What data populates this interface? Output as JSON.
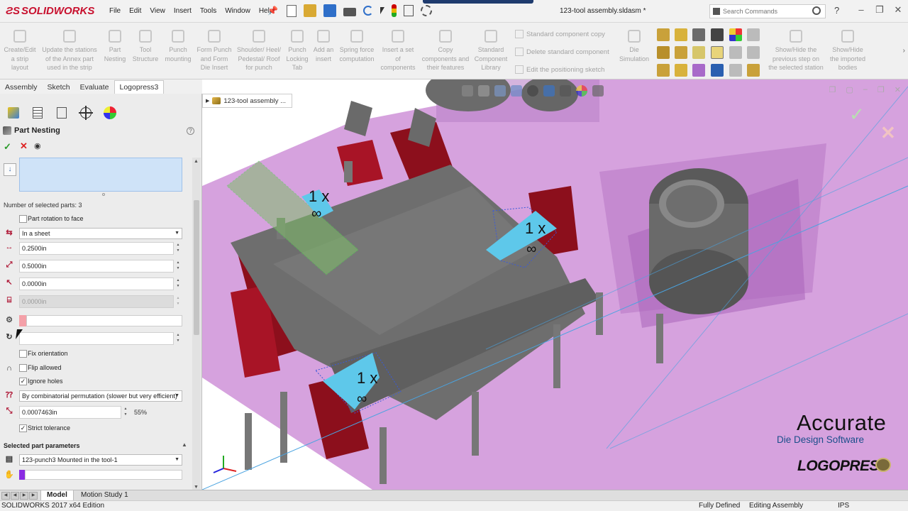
{
  "app": {
    "brand": "SOLIDWORKS",
    "menus": [
      "File",
      "Edit",
      "View",
      "Insert",
      "Tools",
      "Window",
      "Help"
    ],
    "document_title": "123-tool assembly.sldasm *",
    "search_placeholder": "Search Commands"
  },
  "commands": [
    {
      "label": "Create/Edit\na strip\nlayout"
    },
    {
      "label": "Update the stations\nof the Annex part\nused in the strip"
    },
    {
      "label": "Part\nNesting"
    },
    {
      "label": "Tool\nStructure"
    },
    {
      "label": "Punch\nmounting"
    },
    {
      "label": "Form Punch\nand Form\nDie Insert"
    },
    {
      "label": "Shoulder/ Heel/\nPedestal/ Roof\nfor punch"
    },
    {
      "label": "Punch\nLocking\nTab"
    },
    {
      "label": "Add an\ninsert"
    },
    {
      "label": "Spring force\ncomputation"
    },
    {
      "label": "Insert a set\nof\ncomponents"
    },
    {
      "label": "Copy\ncomponents and\ntheir features"
    },
    {
      "label": "Standard\nComponent\nLibrary"
    },
    {
      "label": "Die\nSimulation"
    },
    {
      "label": "Show/Hide the\nprevious step on\nthe selected station"
    },
    {
      "label": "Show/Hide\nthe imported\nbodies"
    }
  ],
  "standard_component": {
    "copy": "Standard component copy",
    "delete": "Delete standard component",
    "edit": "Edit the positioning sketch"
  },
  "cm_tabs": [
    "Assembly",
    "Sketch",
    "Evaluate",
    "Logopress3"
  ],
  "property_manager": {
    "title": "Part Nesting",
    "selected_count": "Number of selected parts: 3",
    "part_rotation_label": "Part rotation to face",
    "layout_mode": "In a sheet",
    "val1": "0.2500in",
    "val2": "0.5000in",
    "val3": "0.0000in",
    "val4": "0.0000in",
    "fix_orientation": "Fix orientation",
    "flip_allowed": "Flip allowed",
    "ignore_holes": "Ignore holes",
    "method": "By combinatorial permutation (slower but very efficient)",
    "tolerance": "0.0007463in",
    "tolerance_pct": "55%",
    "strict_tolerance": "Strict tolerance",
    "selected_params_header": "Selected part parameters",
    "selected_part": "123-punch3 Mounted in the tool-1"
  },
  "viewport": {
    "tree_item": "123-tool assembly ...",
    "nest_labels": [
      "1 x",
      "1 x",
      "1 x"
    ],
    "brand_main": "Accurate",
    "brand_sub": "Die Design Software",
    "brand_logo": "LOGOPRESS"
  },
  "bottom_tabs": [
    "Model",
    "Motion Study 1"
  ],
  "status": {
    "edition": "SOLIDWORKS 2017 x64 Edition",
    "state": "Fully Defined",
    "mode": "Editing Assembly",
    "units": "IPS"
  },
  "colors": {
    "die_magenta": "#b75fc6",
    "red_parts": "#8c0f1c",
    "nest_highlight": "#5ec8ea"
  }
}
